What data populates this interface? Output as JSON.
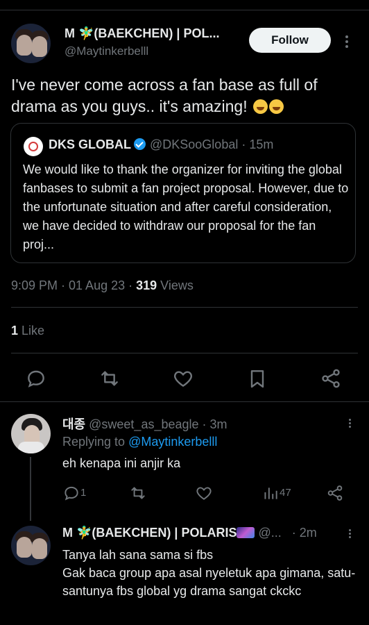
{
  "main_tweet": {
    "display_name": "M 🧚‍♂️(BAEKCHEN) | POL...",
    "handle": "@Maytinkerbelll",
    "follow_label": "Follow",
    "text": "I've never come across a fan base as full of drama as you guys.. it's amazing!",
    "emojis": [
      "rolling-on-floor-laughing",
      "rolling-on-floor-laughing"
    ],
    "quote": {
      "name": "DKS GLOBAL",
      "handle": "@DKSooGlobal",
      "time": "· 15m",
      "text": "We would like to thank the organizer for inviting the global fanbases to submit a fan project proposal. However, due to the unfortunate situation and after careful consideration, we have decided to withdraw our proposal for the fan proj..."
    },
    "timestamp": "9:09 PM · 01 Aug 23 · ",
    "views_count": "319",
    "views_label": " Views",
    "likes_count": "1",
    "likes_label": " Like"
  },
  "actions": [
    "reply-icon",
    "retweet-icon",
    "like-icon",
    "bookmark-icon",
    "share-icon"
  ],
  "reply1": {
    "name": "대종",
    "handle": "@sweet_as_beagle",
    "time": "· 3m",
    "replying_prefix": "Replying to ",
    "replying_to": "@Maytinkerbelll",
    "text": "eh kenapa ini anjir ka",
    "reply_count": "1",
    "views_count": "47"
  },
  "reply2": {
    "name": "M 🧚‍♂️(BAEKCHEN) | POLARIS",
    "handle": "@...",
    "time": "· 2m",
    "text": "Tanya lah sana sama si fbs\nGak baca group apa asal nyeletuk apa gimana, satu-santunya fbs global yg drama sangat ckckc"
  },
  "colors": {
    "background": "#000000",
    "text": "#e7e9ea",
    "muted": "#71767b",
    "accent": "#1d9bf0",
    "divider": "#2f3336"
  }
}
